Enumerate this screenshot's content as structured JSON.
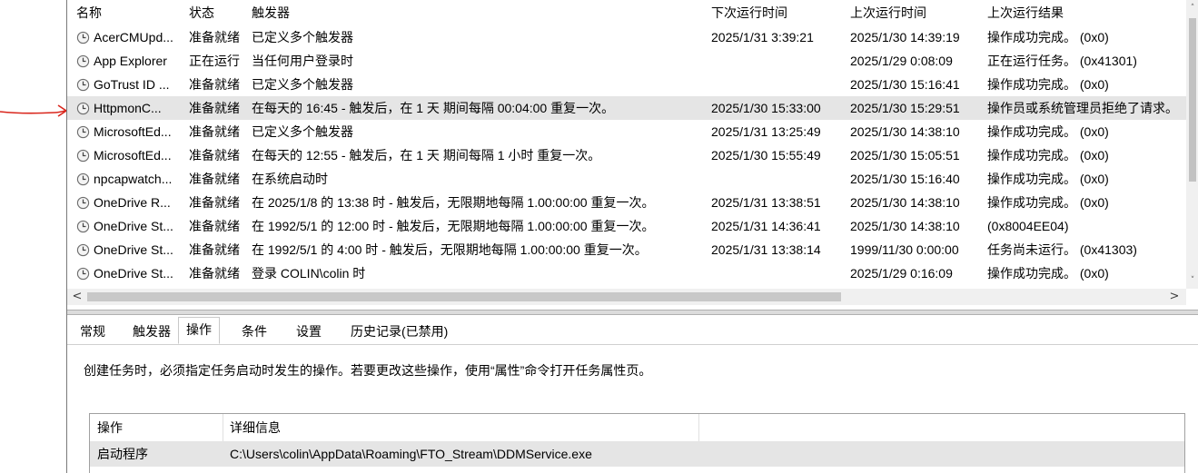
{
  "columns": {
    "name": "名称",
    "status": "状态",
    "trigger": "触发器",
    "next_run": "下次运行时间",
    "last_run": "上次运行时间",
    "last_result": "上次运行结果"
  },
  "tasks": [
    {
      "name": "AcerCMUpd...",
      "status": "准备就绪",
      "trigger": "已定义多个触发器",
      "next_run": "2025/1/31 3:39:21",
      "last_run": "2025/1/30 14:39:19",
      "last_result": "操作成功完成。 (0x0)"
    },
    {
      "name": "App Explorer",
      "status": "正在运行",
      "trigger": "当任何用户登录时",
      "next_run": "",
      "last_run": "2025/1/29 0:08:09",
      "last_result": "正在运行任务。 (0x41301)"
    },
    {
      "name": "GoTrust ID ...",
      "status": "准备就绪",
      "trigger": "已定义多个触发器",
      "next_run": "",
      "last_run": "2025/1/30 15:16:41",
      "last_result": "操作成功完成。 (0x0)"
    },
    {
      "name": "HttpmonC...",
      "status": "准备就绪",
      "trigger": "在每天的 16:45 - 触发后，在 1 天 期间每隔 00:04:00 重复一次。",
      "next_run": "2025/1/30 15:33:00",
      "last_run": "2025/1/30 15:29:51",
      "last_result": "操作员或系统管理员拒绝了请求。"
    },
    {
      "name": "MicrosoftEd...",
      "status": "准备就绪",
      "trigger": "已定义多个触发器",
      "next_run": "2025/1/31 13:25:49",
      "last_run": "2025/1/30 14:38:10",
      "last_result": "操作成功完成。 (0x0)"
    },
    {
      "name": "MicrosoftEd...",
      "status": "准备就绪",
      "trigger": "在每天的 12:55 - 触发后，在 1 天 期间每隔 1 小时 重复一次。",
      "next_run": "2025/1/30 15:55:49",
      "last_run": "2025/1/30 15:05:51",
      "last_result": "操作成功完成。 (0x0)"
    },
    {
      "name": "npcapwatch...",
      "status": "准备就绪",
      "trigger": "在系统启动时",
      "next_run": "",
      "last_run": "2025/1/30 15:16:40",
      "last_result": "操作成功完成。 (0x0)"
    },
    {
      "name": "OneDrive R...",
      "status": "准备就绪",
      "trigger": "在 2025/1/8 的 13:38 时 - 触发后，无限期地每隔 1.00:00:00 重复一次。",
      "next_run": "2025/1/31 13:38:51",
      "last_run": "2025/1/30 14:38:10",
      "last_result": "操作成功完成。 (0x0)"
    },
    {
      "name": "OneDrive St...",
      "status": "准备就绪",
      "trigger": "在 1992/5/1 的 12:00 时 - 触发后，无限期地每隔 1.00:00:00 重复一次。",
      "next_run": "2025/1/31 14:36:41",
      "last_run": "2025/1/30 14:38:10",
      "last_result": "(0x8004EE04)"
    },
    {
      "name": "OneDrive St...",
      "status": "准备就绪",
      "trigger": "在 1992/5/1 的 4:00 时 - 触发后，无限期地每隔 1.00:00:00 重复一次。",
      "next_run": "2025/1/31 13:38:14",
      "last_run": "1999/11/30 0:00:00",
      "last_result": "任务尚未运行。 (0x41303)"
    },
    {
      "name": "OneDrive St...",
      "status": "准备就绪",
      "trigger": "登录 COLIN\\colin 时",
      "next_run": "",
      "last_run": "2025/1/29 0:16:09",
      "last_result": "操作成功完成。 (0x0)"
    }
  ],
  "selected_index": 3,
  "tabs": [
    "常规",
    "触发器",
    "操作",
    "条件",
    "设置",
    "历史记录(已禁用)"
  ],
  "active_tab": "操作",
  "description": "创建任务时，必须指定任务启动时发生的操作。若要更改这些操作，使用“属性”命令打开任务属性页。",
  "actions_table": {
    "headers": [
      "操作",
      "详细信息"
    ],
    "rows": [
      {
        "action": "启动程序",
        "details": "C:\\Users\\colin\\AppData\\Roaming\\FTO_Stream\\DDMService.exe"
      }
    ]
  },
  "scroll": {
    "up": "˄",
    "down": "˅",
    "left": "<",
    "right": ">"
  },
  "colors": {
    "annotation_arrow": "#d9261c",
    "selected_row": "#e5e5e5"
  }
}
